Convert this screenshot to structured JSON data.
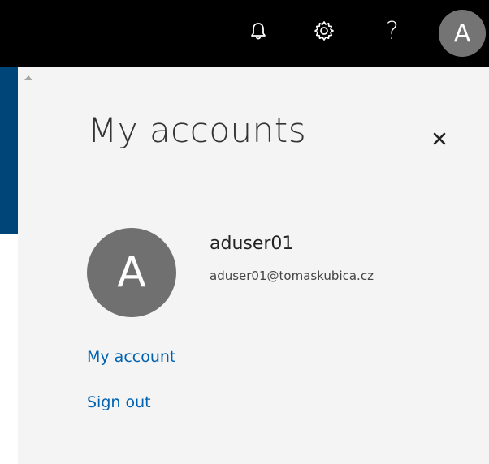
{
  "topbar": {
    "bell_icon": "bell-icon",
    "gear_icon": "gear-icon",
    "help_label": "?",
    "avatar_initial": "A"
  },
  "panel": {
    "title": "My accounts",
    "close_label": "×",
    "user": {
      "initial": "A",
      "name": "aduser01",
      "email": "aduser01@tomaskubica.cz"
    },
    "links": {
      "my_account": "My account",
      "sign_out": "Sign out"
    }
  },
  "colors": {
    "topbar": "#000000",
    "panel_bg": "#f4f4f4",
    "link": "#0062b1",
    "avatar": "#707070",
    "nav_accent": "#004578"
  }
}
